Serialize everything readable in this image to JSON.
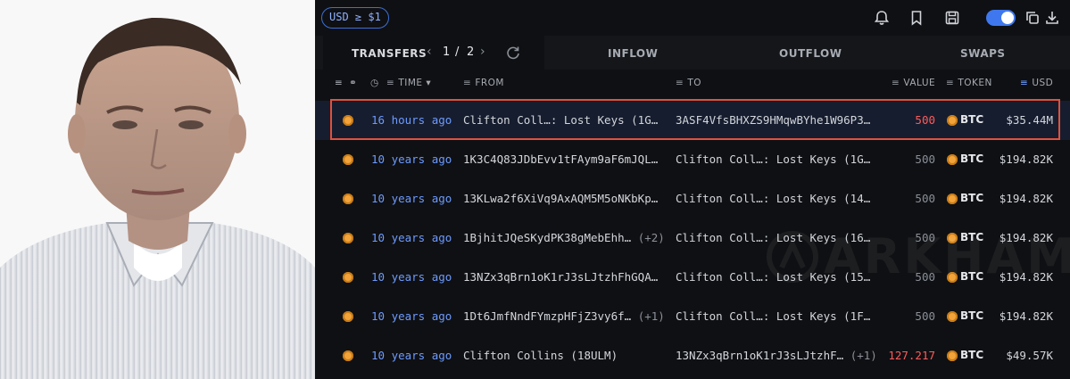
{
  "filter": {
    "label": "USD ≥ $1"
  },
  "tabs": {
    "transfers": "TRANSFERS",
    "page_current": "1",
    "page_sep": "/",
    "page_total": "2",
    "inflow": "INFLOW",
    "outflow": "OUTFLOW",
    "swaps": "SWAPS"
  },
  "columns": {
    "time": "TIME",
    "from": "FROM",
    "to": "TO",
    "value": "VALUE",
    "token": "TOKEN",
    "usd": "USD"
  },
  "watermark": "ARKHAM",
  "rows": [
    {
      "time": "16 hours ago",
      "from": "Clifton Coll…: Lost Keys (1G…",
      "from_extra": "",
      "to": "3ASF4VfsBHXZS9HMqwBYhe1W96P3…",
      "to_extra": "",
      "value": "500",
      "value_color": "#ff5b5b",
      "token": "BTC",
      "usd": "$35.44M"
    },
    {
      "time": "10 years ago",
      "from": "1K3C4Q83JDbEvv1tFAym9aF6mJQL…",
      "from_extra": "",
      "to": "Clifton Coll…: Lost Keys (1G…",
      "to_extra": "",
      "value": "500",
      "value_color": "#8a8f98",
      "token": "BTC",
      "usd": "$194.82K"
    },
    {
      "time": "10 years ago",
      "from": "13KLwa2f6XiVq9AxAQM5M5oNKbKp…",
      "from_extra": "",
      "to": "Clifton Coll…: Lost Keys (14…",
      "to_extra": "",
      "value": "500",
      "value_color": "#8a8f98",
      "token": "BTC",
      "usd": "$194.82K"
    },
    {
      "time": "10 years ago",
      "from": "1BjhitJQeSKydPK38gMebEhh…",
      "from_extra": "(+2)",
      "to": "Clifton Coll…: Lost Keys (16…",
      "to_extra": "",
      "value": "500",
      "value_color": "#8a8f98",
      "token": "BTC",
      "usd": "$194.82K"
    },
    {
      "time": "10 years ago",
      "from": "13NZx3qBrn1oK1rJ3sLJtzhFhGQA…",
      "from_extra": "",
      "to": "Clifton Coll…: Lost Keys (15…",
      "to_extra": "",
      "value": "500",
      "value_color": "#8a8f98",
      "token": "BTC",
      "usd": "$194.82K"
    },
    {
      "time": "10 years ago",
      "from": "1Dt6JmfNndFYmzpHFjZ3vy6f…",
      "from_extra": "(+1)",
      "to": "Clifton Coll…: Lost Keys (1F…",
      "to_extra": "",
      "value": "500",
      "value_color": "#8a8f98",
      "token": "BTC",
      "usd": "$194.82K"
    },
    {
      "time": "10 years ago",
      "from": "Clifton Collins (18ULM)",
      "from_extra": "",
      "to": "13NZx3qBrn1oK1rJ3sLJtzhF…",
      "to_extra": "(+1)",
      "value": "127.217",
      "value_color": "#ff5b5b",
      "token": "BTC",
      "usd": "$49.57K"
    }
  ],
  "colors": {
    "accent": "#3f78ee",
    "link": "#6d9bff",
    "highlight_frame": "#e0513e",
    "btc": "#f2a33a"
  },
  "icons": [
    "bell-icon",
    "bookmark-icon",
    "save-icon",
    "copy-icon",
    "download-icon",
    "refresh-icon",
    "link-icon",
    "clock-icon",
    "filter-icon",
    "bitcoin-icon"
  ]
}
